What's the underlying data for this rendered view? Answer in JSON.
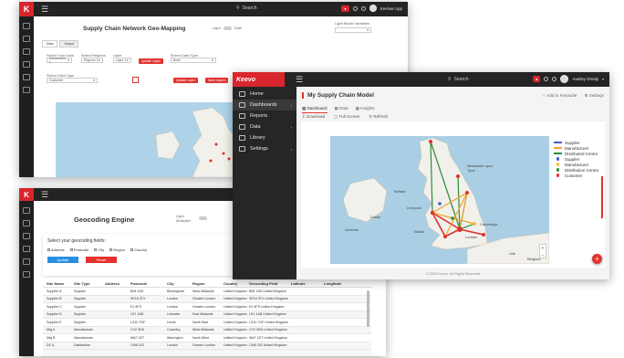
{
  "window1": {
    "logo": "K",
    "search_label": "Search",
    "badge": "●",
    "user": "Keelvar App",
    "title": "Supply Chain Network Geo-Mapping",
    "toggle_label": "Light",
    "toggle_label2": "Dark",
    "filters_label": "Light Model Variables",
    "tabs": [
      "Data",
      "Output"
    ],
    "fields": [
      {
        "label": "Select Your Data",
        "value": "Conversion 1"
      },
      {
        "label": "Select Regions",
        "value": "Regions 1"
      },
      {
        "label": "Layer",
        "value": "Layer 1"
      },
      {
        "label": "Select Data Type",
        "value": "None"
      }
    ],
    "btn1": "Update Layer",
    "btn2": "Update Layer",
    "btn3": "Save Layers",
    "select_label": "Select Data Type",
    "select_value": "Customer"
  },
  "window2": {
    "title": "Geocoding Engine",
    "toggle": "Light Multiplier",
    "select_prompt": "Select your geocoding fields:",
    "checks": [
      "Address",
      "Postcode",
      "City",
      "Region",
      "Country"
    ],
    "btn_update": "Update",
    "btn_reset": "Reset",
    "columns": [
      "Site Name",
      "Site Type",
      "Address",
      "Postcode",
      "City",
      "Region",
      "Country",
      "Geocoding Field",
      "Latitude",
      "Longitude"
    ],
    "rows": [
      [
        "Supplier A",
        "Supplier",
        "",
        "B94 1AD",
        "Birmingham",
        "West Midlands",
        "United Kingdom",
        "B94 1AD United Kingdom",
        "",
        ""
      ],
      [
        "Supplier B",
        "Supplier",
        "",
        "SE16 3TX",
        "London",
        "Greater London",
        "United Kingdom",
        "SE16 3TX United Kingdom",
        "",
        ""
      ],
      [
        "Supplier C",
        "Supplier",
        "",
        "E1 8FS",
        "London",
        "Greater London",
        "United Kingdom",
        "E1 8FS United Kingdom",
        "",
        ""
      ],
      [
        "Supplier D",
        "Supplier",
        "",
        "LE1 1AB",
        "Leicester",
        "East Midlands",
        "United Kingdom",
        "LE1 1AB United Kingdom",
        "",
        ""
      ],
      [
        "Supplier E",
        "Supplier",
        "",
        "LS10 7GF",
        "Leeds",
        "North East",
        "United Kingdom",
        "LS10 7GF United Kingdom",
        "",
        ""
      ],
      [
        "Mfg A",
        "Manufacturer",
        "",
        "CV2 5DD",
        "Coventry",
        "West Midlands",
        "United Kingdom",
        "CV2 5DD United Kingdom",
        "",
        ""
      ],
      [
        "Mfg B",
        "Manufacturer",
        "",
        "WA7 1ET",
        "Warrington",
        "North West",
        "United Kingdom",
        "WA7 1ET United Kingdom",
        "",
        ""
      ],
      [
        "DC A",
        "Distribution",
        "",
        "CM8 3JS",
        "London",
        "Greater London",
        "United Kingdom",
        "CM8 3JS United Kingdom",
        "",
        ""
      ]
    ]
  },
  "window3": {
    "logo": "Keevo",
    "search_label": "Search",
    "badge": "●",
    "user": "Audrey Omaly",
    "sidebar": [
      "Home",
      "Dashboards",
      "Reports",
      "Data",
      "Library",
      "Settings"
    ],
    "title": "My Supply Chain Model",
    "add_fav": "Add to Favourite",
    "settings": "Settings",
    "tabs": [
      "Dashboard",
      "Data",
      "Insights"
    ],
    "actions": [
      "Download",
      "Full Screen",
      "Refresh"
    ],
    "legend": [
      {
        "label": "Supplier",
        "color": "#3a5fc8",
        "kind": "line"
      },
      {
        "label": "Manufacturer",
        "color": "#f0a32a",
        "kind": "line"
      },
      {
        "label": "Distributed Centre",
        "color": "#2e8b3b",
        "kind": "line"
      },
      {
        "label": "Supplier",
        "color": "#3a5fc8",
        "kind": "dot"
      },
      {
        "label": "Manufacturer",
        "color": "#f0c030",
        "kind": "dot"
      },
      {
        "label": "Distribution Centre",
        "color": "#2e8b3b",
        "kind": "dot"
      },
      {
        "label": "Customer",
        "color": "#e0312e",
        "kind": "dot"
      }
    ],
    "map_labels": [
      "Belfast",
      "Liverpool",
      "Dublin",
      "Cambridge",
      "London",
      "Limerick",
      "Wales",
      "Newcastle upon Tyne",
      "Lille",
      "Belgium"
    ],
    "footer": "© 2023 Keevo. All Rights Reserved",
    "fab": "+"
  }
}
